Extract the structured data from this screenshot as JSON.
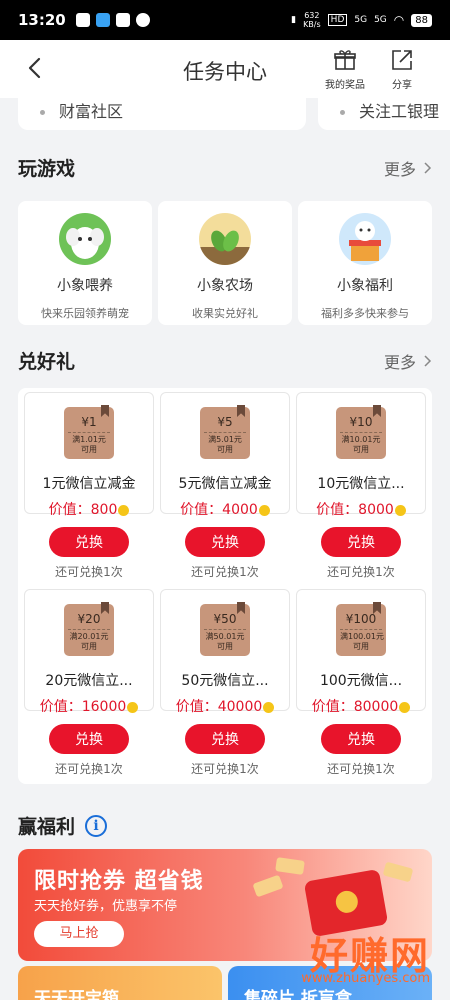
{
  "status_bar": {
    "time": "13:20",
    "net_speed": "632\nKB/s",
    "hd": "HD",
    "signal1": "5G",
    "signal2": "5G",
    "battery": "88"
  },
  "nav": {
    "title": "任务中心",
    "my_prizes_label": "我的奖品",
    "share_label": "分享"
  },
  "prev_cards": [
    "财富社区",
    "关注工银理"
  ],
  "play": {
    "title": "玩游戏",
    "more": "更多",
    "games": [
      {
        "name": "小象喂养",
        "desc": "快来乐园领养萌宠",
        "icon": "elephant-icon"
      },
      {
        "name": "小象农场",
        "desc": "收果实兑好礼",
        "icon": "farm-icon"
      },
      {
        "name": "小象福利",
        "desc": "福利多多快来参与",
        "icon": "gift-elephant-icon"
      }
    ]
  },
  "redeem": {
    "title": "兑好礼",
    "more": "更多",
    "price_label": "价值：",
    "button_label": "兑换",
    "items": [
      {
        "coupon_amount": "¥1",
        "coupon_cond": "满1.01元\n可用",
        "name": "1元微信立减金",
        "price": "800",
        "remaining": "还可兑换1次"
      },
      {
        "coupon_amount": "¥5",
        "coupon_cond": "满5.01元\n可用",
        "name": "5元微信立减金",
        "price": "4000",
        "remaining": "还可兑换1次"
      },
      {
        "coupon_amount": "¥10",
        "coupon_cond": "满10.01元\n可用",
        "name": "10元微信立...",
        "price": "8000",
        "remaining": "还可兑换1次"
      },
      {
        "coupon_amount": "¥20",
        "coupon_cond": "满20.01元\n可用",
        "name": "20元微信立...",
        "price": "16000",
        "remaining": "还可兑换1次"
      },
      {
        "coupon_amount": "¥50",
        "coupon_cond": "满50.01元\n可用",
        "name": "50元微信立...",
        "price": "40000",
        "remaining": "还可兑换1次"
      },
      {
        "coupon_amount": "¥100",
        "coupon_cond": "满100.01元\n可用",
        "name": "100元微信...",
        "price": "80000",
        "remaining": "还可兑换1次"
      }
    ]
  },
  "benefits": {
    "title": "赢福利",
    "banner": {
      "title": "限时抢券 超省钱",
      "subtitle": "天天抢好券，优惠享不停",
      "cta": "马上抢"
    },
    "mini_cards": [
      "天天开宝箱",
      "集碎片 拆盲盒"
    ]
  },
  "watermark": {
    "text": "好赚网",
    "url": "www.zhuanyes.com"
  },
  "colors": {
    "accent_red": "#e8142b",
    "banner_red": "#f24b3a",
    "info_blue": "#1a6ed8",
    "coin_yellow": "#f5c518"
  }
}
